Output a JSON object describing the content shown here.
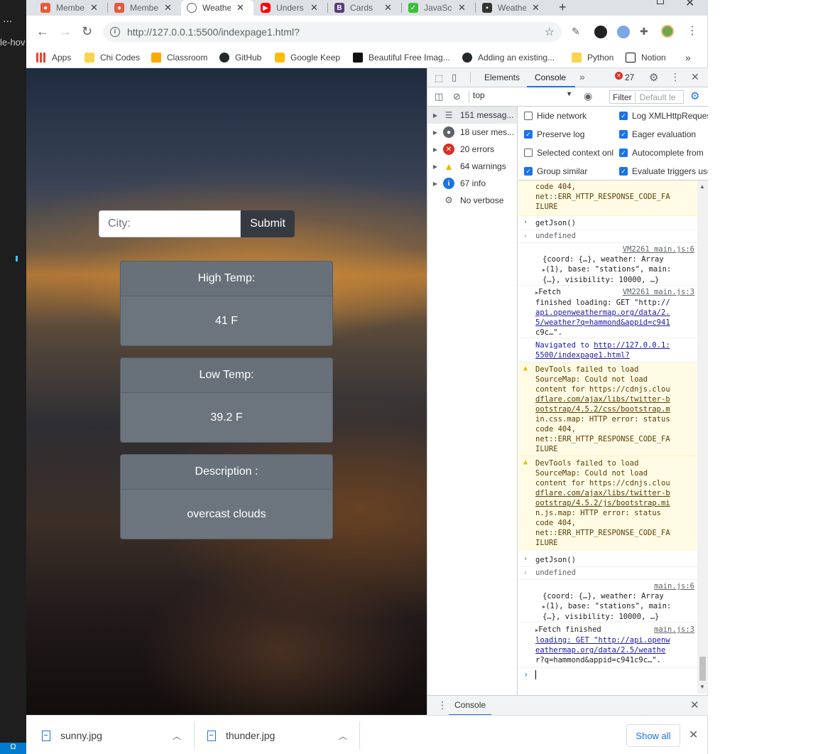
{
  "editor": {
    "sidebar_label": "le-hov",
    "menu_dots": "...",
    "status": "Ω"
  },
  "tabs": [
    {
      "title": "Membe",
      "favicon_color": "#e8593b",
      "active": false
    },
    {
      "title": "Membe",
      "favicon_color": "#e8593b",
      "active": false
    },
    {
      "title": "Weathe",
      "favicon_color": "#5f6368",
      "active": true
    },
    {
      "title": "Unders",
      "favicon_color": "#ff0000",
      "active": false
    },
    {
      "title": "Cards",
      "favicon_color": "#563d7c",
      "active": false
    },
    {
      "title": "JavaScr",
      "favicon_color": "#3dbf3d",
      "active": false
    },
    {
      "title": "Weathe",
      "favicon_color": "#333333",
      "active": false
    }
  ],
  "new_tab": "+",
  "address_bar": {
    "url": "http://127.0.0.1:5500/indexpage1.html?"
  },
  "bookmarks": [
    {
      "label": "Apps",
      "icon_color": "#4285f4"
    },
    {
      "label": "Chi Codes",
      "icon_color": "#fcd34d"
    },
    {
      "label": "Classroom",
      "icon_color": "#f9ab00"
    },
    {
      "label": "GitHub",
      "icon_color": "#24292e"
    },
    {
      "label": "Google Keep",
      "icon_color": "#fbbc04"
    },
    {
      "label": "Beautiful Free Imag...",
      "icon_color": "#111111"
    },
    {
      "label": "Adding an existing...",
      "icon_color": "#24292e"
    },
    {
      "label": "Python",
      "icon_color": "#fcd34d"
    },
    {
      "label": "Notion",
      "icon_color": "#111111"
    }
  ],
  "bookmarks_more": "»",
  "weather_app": {
    "city_placeholder": "City:",
    "submit_label": "Submit",
    "cards": [
      {
        "header": "High Temp:",
        "value": "41 F"
      },
      {
        "header": "Low Temp:",
        "value": "39.2 F"
      },
      {
        "header": "Description :",
        "value": "overcast clouds"
      }
    ]
  },
  "devtools": {
    "tabs": [
      "Elements",
      "Console"
    ],
    "active_tab": "Console",
    "error_count": "27",
    "context": "top",
    "filter_label": "Filter",
    "filter_placeholder": "Default le",
    "sidebar": [
      {
        "label": "151 messag...",
        "icon": "list-icon"
      },
      {
        "label": "18 user mes...",
        "icon": "user-icon"
      },
      {
        "label": "20 errors",
        "icon": "error-icon"
      },
      {
        "label": "64 warnings",
        "icon": "warning-icon"
      },
      {
        "label": "67 info",
        "icon": "info-icon"
      },
      {
        "label": "No verbose",
        "icon": "gear-icon"
      }
    ],
    "settings": [
      {
        "label": "Hide network",
        "checked": false
      },
      {
        "label": "Log XMLHttpReques",
        "checked": true
      },
      {
        "label": "Preserve log",
        "checked": true
      },
      {
        "label": "Eager evaluation",
        "checked": true
      },
      {
        "label": "Selected context onl",
        "checked": false
      },
      {
        "label": "Autocomplete from",
        "checked": true
      },
      {
        "label": "Group similar",
        "checked": true
      },
      {
        "label": "Evaluate triggers use",
        "checked": true
      }
    ],
    "console": {
      "top_warning_tail": [
        "code 404,",
        "net::ERR_HTTP_RESPONSE_CODE_FA",
        "ILURE"
      ],
      "input1": "getJson()",
      "output1": "undefined",
      "obj1_src": "VM2261 main.js:6",
      "obj1_lines": [
        "{coord: {…}, weather: Array",
        "(1), base: \"stations\", main:",
        "{…}, visibility: 10000, …}"
      ],
      "fetch1_src": "VM2261 main.js:3",
      "fetch1_lines": [
        "Fetch",
        "finished loading: GET \"http://",
        "api.openweathermap.org/data/2.",
        "5/weather?q=hammond&appid=c941",
        "c9c…\"."
      ],
      "nav_prefix": "Navigated to ",
      "nav_url_lines": [
        "http://127.0.0.1:",
        "5500/indexpage1.html?"
      ],
      "warn1_lines": [
        "DevTools failed to load",
        "SourceMap: Could not load",
        "content for https://cdnjs.clou",
        "dflare.com/ajax/libs/twitter-b",
        "ootstrap/4.5.2/css/bootstrap.m",
        "in.css.map: HTTP error: status",
        "code 404,",
        "net::ERR_HTTP_RESPONSE_CODE_FA",
        "ILURE"
      ],
      "warn2_lines": [
        "DevTools failed to load",
        "SourceMap: Could not load",
        "content for https://cdnjs.clou",
        "dflare.com/ajax/libs/twitter-b",
        "ootstrap/4.5.2/js/bootstrap.mi",
        "n.js.map: HTTP error: status",
        "code 404,",
        "net::ERR_HTTP_RESPONSE_CODE_FA",
        "ILURE"
      ],
      "input2": "getJson()",
      "output2": "undefined",
      "obj2_src": "main.js:6",
      "obj2_lines": [
        "{coord: {…}, weather: Array",
        "(1), base: \"stations\", main:",
        "{…}, visibility: 10000, …}"
      ],
      "fetch2_src": "main.js:3",
      "fetch2_lines": [
        "Fetch finished",
        "loading: GET \"http://api.openw",
        "eathermap.org/data/2.5/weathe",
        "r?q=hammond&appid=c941c9c…\"."
      ]
    },
    "drawer_tab": "Console"
  },
  "downloads": [
    {
      "name": "sunny.jpg"
    },
    {
      "name": "thunder.jpg"
    }
  ],
  "show_all_label": "Show all"
}
